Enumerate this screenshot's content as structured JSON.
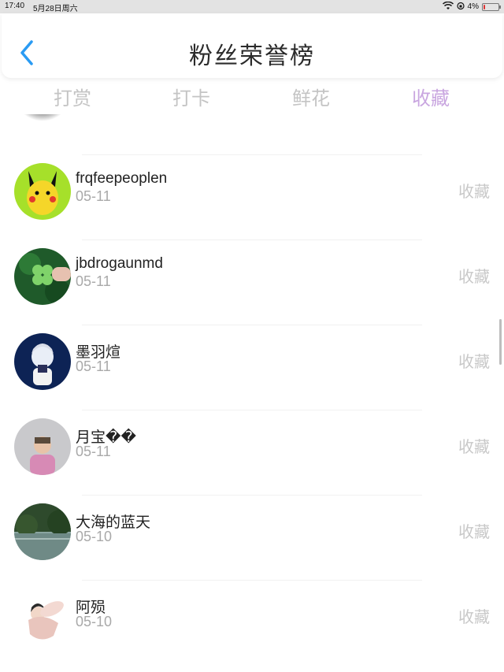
{
  "status_bar": {
    "time": "17:40",
    "date": "5月28日周六",
    "battery_percent": "4%"
  },
  "header": {
    "title": "粉丝荣誉榜",
    "back_icon": "chevron-left-icon",
    "accent_color": "#2a9bf3"
  },
  "tabs": [
    {
      "label": "打赏",
      "active": false
    },
    {
      "label": "打卡",
      "active": false
    },
    {
      "label": "鲜花",
      "active": false
    },
    {
      "label": "收藏",
      "active": true
    }
  ],
  "list": {
    "rows": [
      {
        "name": "frqfeepeoplen",
        "date": "05-11",
        "action": "收藏"
      },
      {
        "name": "jbdrogaunmd",
        "date": "05-11",
        "action": "收藏"
      },
      {
        "name": "墨羽煊",
        "date": "05-11",
        "action": "收藏"
      },
      {
        "name": "月宝��",
        "date": "05-11",
        "action": "收藏"
      },
      {
        "name": "大海的蓝天",
        "date": "05-10",
        "action": "收藏"
      },
      {
        "name": "阿殒",
        "date": "05-10",
        "action": "收藏"
      }
    ]
  },
  "colors": {
    "active_tab": "#c9a6e0",
    "inactive_tab": "#c4c4c4",
    "date_text": "#a9a9a9",
    "action_text": "#c8c8c8"
  }
}
